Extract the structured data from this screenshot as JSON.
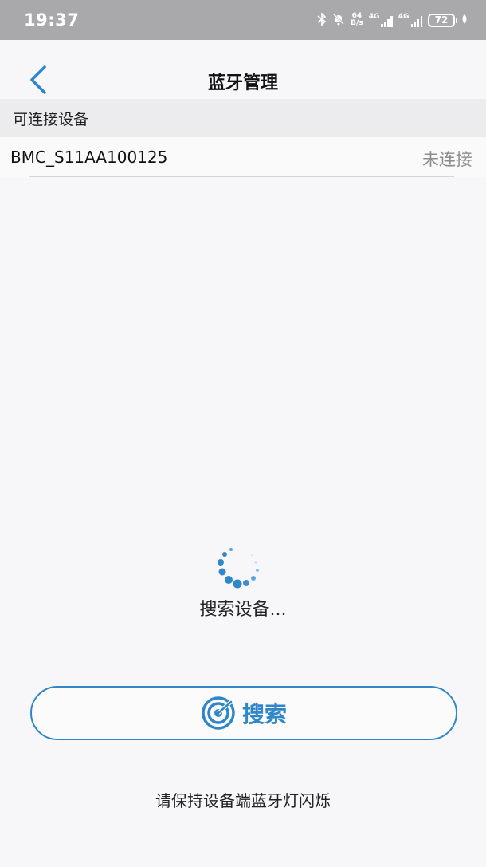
{
  "status_bar": {
    "time": "19:37",
    "speed_value": "64",
    "speed_unit": "B/s",
    "net1_label": "4G",
    "net2_label": "4G",
    "battery": "72",
    "icons": [
      "bluetooth-icon",
      "mute-bell-icon",
      "signal-icon",
      "battery-icon",
      "leaf-icon"
    ]
  },
  "nav": {
    "title": "蓝牙管理",
    "back_icon": "chevron-left-icon"
  },
  "section": {
    "title": "可连接设备"
  },
  "devices": [
    {
      "name": "BMC_S11AA100125",
      "status": "未连接"
    }
  ],
  "scan": {
    "status_text": "搜索设备..."
  },
  "search_button": {
    "label": "搜索",
    "icon": "radar-icon"
  },
  "hint": "请保持设备端蓝牙灯闪烁",
  "colors": {
    "accent": "#2f86c9",
    "status_bar": "#a9a9ab",
    "section_bg": "#ececee",
    "muted_text": "#8c8c90"
  }
}
